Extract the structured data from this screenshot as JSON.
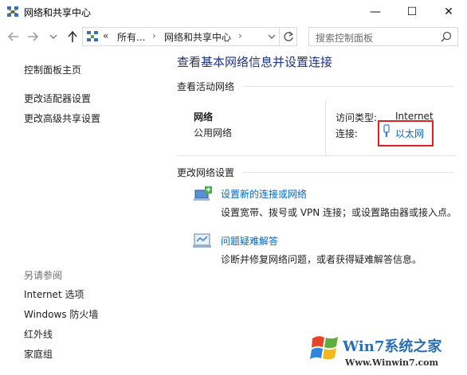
{
  "window": {
    "title": "网络和共享中心",
    "controls": {
      "minimize": "—",
      "maximize": "☐",
      "close": "✕"
    }
  },
  "nav": {
    "back_icon": "arrow-left-icon",
    "forward_icon": "arrow-right-icon",
    "recent_icon": "chevron-down-icon",
    "up_icon": "arrow-up-icon",
    "breadcrumb": [
      "«",
      "所有...",
      "›",
      "网络和共享中心",
      "›"
    ],
    "refresh_icon": "refresh-icon",
    "search_placeholder": "搜索控制面板"
  },
  "sidebar": {
    "links": [
      "控制面板主页",
      "更改适配器设置",
      "更改高级共享设置"
    ],
    "see_also_label": "另请参阅",
    "see_also": [
      "Internet 选项",
      "Windows 防火墙",
      "红外线",
      "家庭组"
    ]
  },
  "main": {
    "title": "查看基本网络信息并设置连接",
    "active_section": "查看活动网络",
    "network": {
      "name": "网络",
      "type": "公用网络",
      "access_label": "访问类型:",
      "access_value": "Internet",
      "connection_label": "连接:",
      "connection_value": "以太网"
    },
    "change_section": "更改网络设置",
    "actions": [
      {
        "title": "设置新的连接或网络",
        "desc": "设置宽带、拨号或 VPN 连接；或设置路由器或接入点。"
      },
      {
        "title": "问题疑难解答",
        "desc": "诊断并修复网络问题，或者获得疑难解答信息。"
      }
    ]
  },
  "watermark": {
    "text": "Win7系统之家",
    "url": "Www.Winwin7.com"
  },
  "colors": {
    "link": "#0066cc",
    "title": "#1e3287",
    "highlight": "#e02020"
  }
}
